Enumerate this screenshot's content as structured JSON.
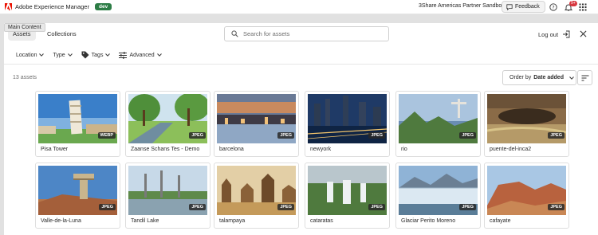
{
  "shell": {
    "app_name": "Adobe Experience Manager",
    "env_badge": "dev",
    "org": "3Share Americas Partner Sandbox",
    "feedback_label": "Feedback",
    "notif_count": "9+"
  },
  "tooltip": "Main Content",
  "tabs": [
    {
      "label": "Assets"
    },
    {
      "label": "Collections"
    }
  ],
  "search": {
    "placeholder": "Search for assets"
  },
  "logout_label": "Log out",
  "filters": [
    {
      "label": "Location"
    },
    {
      "label": "Type"
    },
    {
      "label": "Tags"
    },
    {
      "label": "Advanced"
    }
  ],
  "results": {
    "count": "13 assets",
    "order_prefix": "Order by",
    "order_value": "Date added"
  },
  "assets": [
    {
      "title": "Pisa Tower",
      "format": "WEBP"
    },
    {
      "title": "Zaanse Schans Tes - Demo",
      "format": "JPEG"
    },
    {
      "title": "barcelona",
      "format": "JPEG"
    },
    {
      "title": "newyork",
      "format": "JPEG"
    },
    {
      "title": "rio",
      "format": "JPEG"
    },
    {
      "title": "puente-del-inca2",
      "format": "JPEG"
    },
    {
      "title": "Valle-de-la-Luna",
      "format": "JPEG"
    },
    {
      "title": "Tandil Lake",
      "format": "JPEG"
    },
    {
      "title": "talampaya",
      "format": "JPEG"
    },
    {
      "title": "cataratas",
      "format": "JPEG"
    },
    {
      "title": "Glaciar Perito Moreno",
      "format": "JPEG"
    },
    {
      "title": "cafayate",
      "format": "JPEG"
    }
  ],
  "colors": {
    "env_badge": "#2d7d46",
    "notif": "#d7373f",
    "adobe": "#eb1000"
  }
}
